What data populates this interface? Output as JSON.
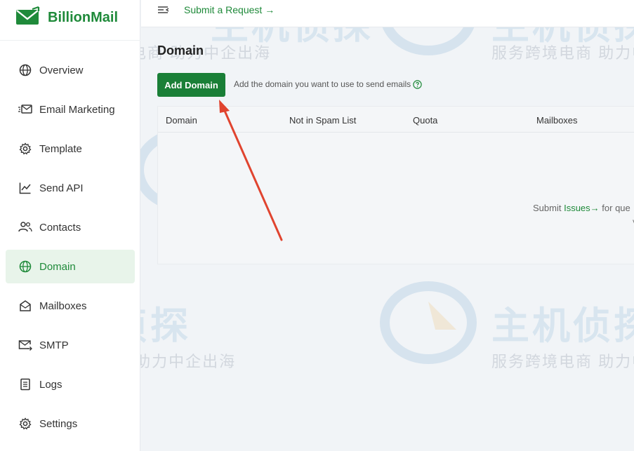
{
  "brand": {
    "name": "BillionMail",
    "accent": "#1f8a3a"
  },
  "topbar": {
    "submit_request": "Submit a Request",
    "submit_arrow": "→"
  },
  "sidebar": {
    "items": [
      {
        "label": "Overview",
        "icon": "globe-icon",
        "active": false
      },
      {
        "label": "Email Marketing",
        "icon": "mail-send-icon",
        "active": false
      },
      {
        "label": "Template",
        "icon": "gear-icon",
        "active": false
      },
      {
        "label": "Send API",
        "icon": "line-chart-icon",
        "active": false
      },
      {
        "label": "Contacts",
        "icon": "users-icon",
        "active": false
      },
      {
        "label": "Domain",
        "icon": "globe-icon",
        "active": true
      },
      {
        "label": "Mailboxes",
        "icon": "mailbox-icon",
        "active": false
      },
      {
        "label": "SMTP",
        "icon": "mail-forward-icon",
        "active": false
      },
      {
        "label": "Logs",
        "icon": "document-icon",
        "active": false
      },
      {
        "label": "Settings",
        "icon": "gear-icon",
        "active": false
      }
    ]
  },
  "main": {
    "title": "Domain",
    "add_button": "Add Domain",
    "hint": "Add the domain you want to use to send emails",
    "table": {
      "columns": [
        "Domain",
        "Not in Spam List",
        "Quota",
        "Mailboxes"
      ]
    },
    "empty": {
      "prefix": "Submit",
      "link": "Issues",
      "arrow": "→",
      "suffix": "for que",
      "line2": "V"
    }
  },
  "watermark": {
    "logo_text": "主机侦探",
    "slogan": "服务跨境电商  助力中企出海"
  }
}
